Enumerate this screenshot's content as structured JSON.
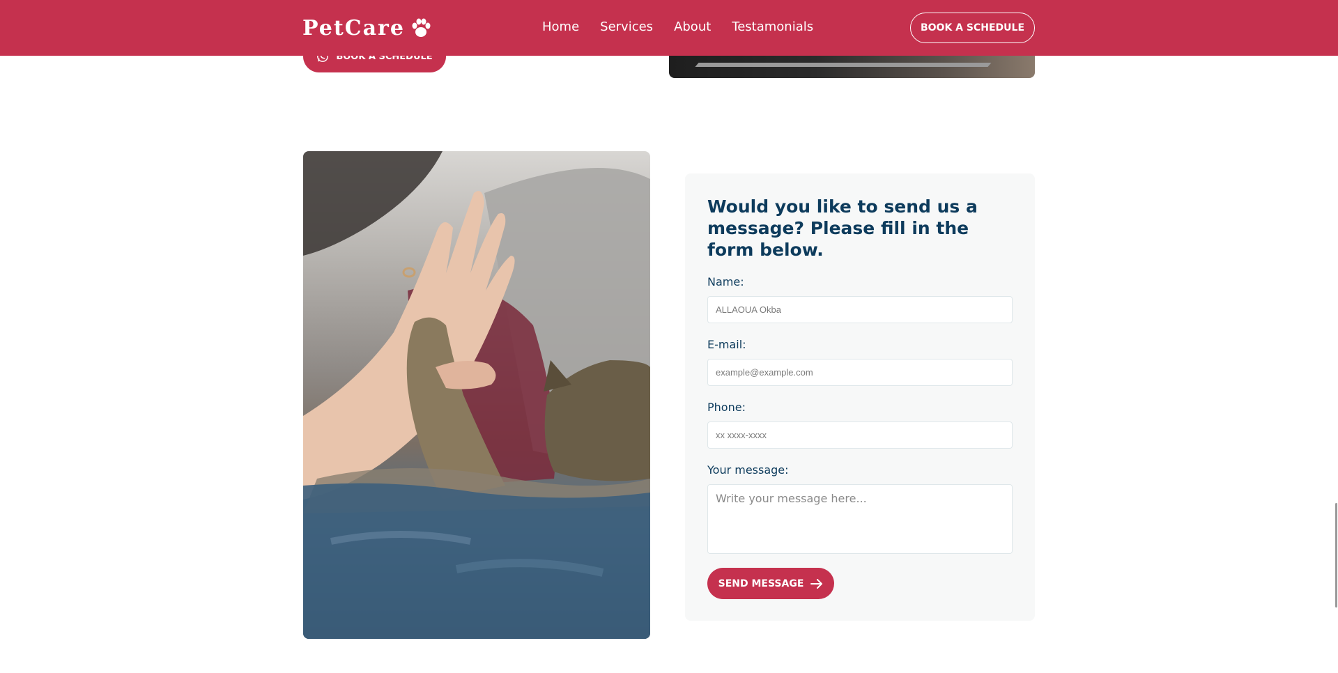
{
  "header": {
    "logo_text": "PetCare",
    "nav": [
      {
        "label": "Home"
      },
      {
        "label": "Services"
      },
      {
        "label": "About"
      },
      {
        "label": "Testamonials"
      }
    ],
    "cta_label": "BOOK A SCHEDULE",
    "brand_color": "#c5314e"
  },
  "hero_peek": {
    "cta_label": "BOOK A SCHEDULE",
    "cta_icon": "whatsapp-icon"
  },
  "form": {
    "title": "Would you like to send us a message? Please fill in the form below.",
    "name_label": "Name:",
    "name_placeholder": "ALLAOUA Okba",
    "email_label": "E-mail:",
    "email_placeholder": "example@example.com",
    "phone_label": "Phone:",
    "phone_placeholder": "xx xxxx-xxxx",
    "message_label": "Your message:",
    "message_placeholder": "Write your message here...",
    "submit_label": "SEND MESSAGE",
    "submit_icon": "arrow-right-icon"
  }
}
